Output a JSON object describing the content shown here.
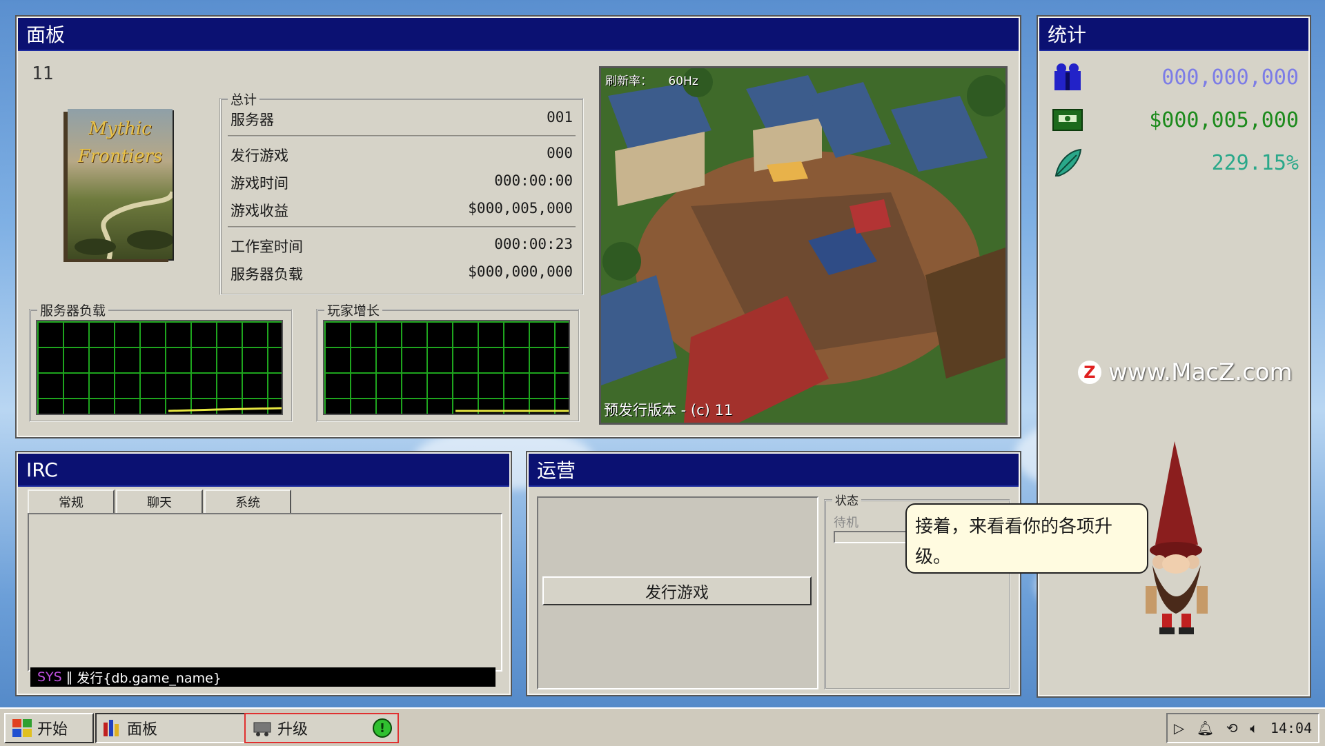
{
  "panel": {
    "title": "面板",
    "game_id": "11",
    "cover_lines": [
      "Mythic",
      "Frontiers"
    ],
    "totals": {
      "group_title": "总计",
      "rows": [
        {
          "label": "服务器",
          "value": "001"
        },
        {
          "label": "发行游戏",
          "value": "000"
        },
        {
          "label": "游戏时间",
          "value": "000:00:00"
        },
        {
          "label": "游戏收益",
          "value": "$000,005,000"
        },
        {
          "label": "工作室时间",
          "value": "000:00:23"
        },
        {
          "label": "服务器负载",
          "value": "$000,000,000"
        }
      ]
    },
    "server_load_title": "服务器负载",
    "player_growth_title": "玩家增长",
    "preview": {
      "refresh_label": "刷新率：",
      "refresh_value": "60Hz",
      "caption": "预发行版本 - (c) 11"
    }
  },
  "stats": {
    "title": "统计",
    "players": "000,000,000",
    "money": "$000,005,000",
    "percent": "229.15%",
    "icons": [
      "people-icon",
      "money-icon",
      "feather-icon"
    ]
  },
  "irc": {
    "title": "IRC",
    "tabs": [
      "常规",
      "聊天",
      "系统"
    ],
    "input_prefix": "SYS",
    "input_text": "发行{db.game_name}"
  },
  "ops": {
    "title": "运营",
    "publish_button": "发行游戏",
    "status_group": "状态",
    "status_value": "待机"
  },
  "assistant": {
    "speech": "接着，来看看你的各项升级。"
  },
  "watermark": "www.MacZ.com",
  "taskbar": {
    "start": "开始",
    "panel": "面板",
    "upgrade": "升级",
    "time": "14:04"
  },
  "colors": {
    "title_bar": "#0b1172",
    "graph_grid": "#1ea51e",
    "stat_players": "#2a2ad8",
    "stat_money": "#1c8a1c",
    "stat_percent": "#2aa88a"
  }
}
